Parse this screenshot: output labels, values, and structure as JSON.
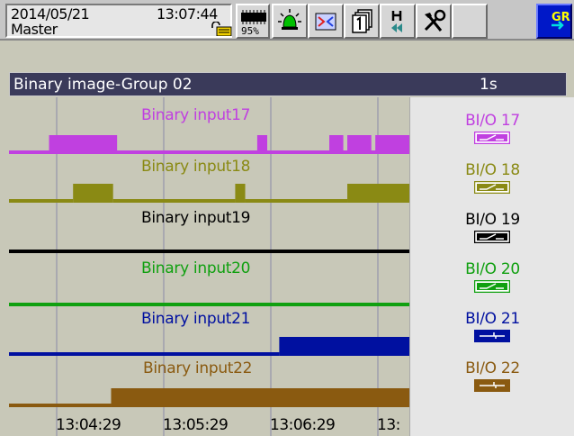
{
  "status": {
    "date": "2014/05/21",
    "time": "13:07:44",
    "mode": "Master",
    "memory_percent": "95%"
  },
  "toolbar": {
    "icons": [
      "memory-icon",
      "alarm-icon",
      "message-icon",
      "group-icon",
      "history-icon",
      "tools-icon",
      "blank",
      "gr-icon"
    ],
    "gr_label": "GR"
  },
  "title": {
    "text": "Binary image-Group 02",
    "rate": "1s"
  },
  "chart_data": {
    "type": "line",
    "x_tick_labels": [
      "13:04:29",
      "13:05:29",
      "13:06:29",
      "13:"
    ],
    "series": [
      {
        "name": "Binary input17",
        "color": "#c040e0",
        "segments": [
          [
            0,
            1,
            0
          ],
          [
            0.1,
            0.27,
            1
          ],
          [
            0.27,
            0.62,
            0
          ],
          [
            0.62,
            0.645,
            1
          ],
          [
            0.645,
            0.8,
            0
          ],
          [
            0.8,
            0.835,
            1
          ],
          [
            0.835,
            0.845,
            0
          ],
          [
            0.845,
            0.905,
            1
          ],
          [
            0.905,
            0.915,
            0
          ],
          [
            0.915,
            1,
            1
          ]
        ]
      },
      {
        "name": "Binary input18",
        "color": "#8a8a14",
        "segments": [
          [
            0,
            0.16,
            0
          ],
          [
            0.16,
            0.26,
            1
          ],
          [
            0.26,
            0.565,
            0
          ],
          [
            0.565,
            0.59,
            1
          ],
          [
            0.59,
            0.845,
            0
          ],
          [
            0.845,
            1,
            1
          ]
        ]
      },
      {
        "name": "Binary input19",
        "color": "#000000",
        "segments": [
          [
            0,
            1,
            0
          ]
        ]
      },
      {
        "name": "Binary input20",
        "color": "#10a010",
        "segments": [
          [
            0,
            1,
            0
          ]
        ]
      },
      {
        "name": "Binary input21",
        "color": "#0010a0",
        "segments": [
          [
            0,
            0.675,
            0
          ],
          [
            0.675,
            1,
            1
          ]
        ]
      },
      {
        "name": "Binary input22",
        "color": "#8a5a10",
        "segments": [
          [
            0,
            0.255,
            0
          ],
          [
            0.255,
            1,
            1
          ]
        ]
      }
    ]
  },
  "legend": [
    {
      "label": "BI/O 17",
      "color": "#c040e0",
      "swatch": "open"
    },
    {
      "label": "BI/O 18",
      "color": "#8a8a14",
      "swatch": "open"
    },
    {
      "label": "BI/O 19",
      "color": "#000000",
      "swatch": "open"
    },
    {
      "label": "BI/O 20",
      "color": "#10a010",
      "swatch": "open"
    },
    {
      "label": "BI/O 21",
      "color": "#0010a0",
      "swatch": "closed"
    },
    {
      "label": "BI/O 22",
      "color": "#8a5a10",
      "swatch": "closed"
    }
  ]
}
